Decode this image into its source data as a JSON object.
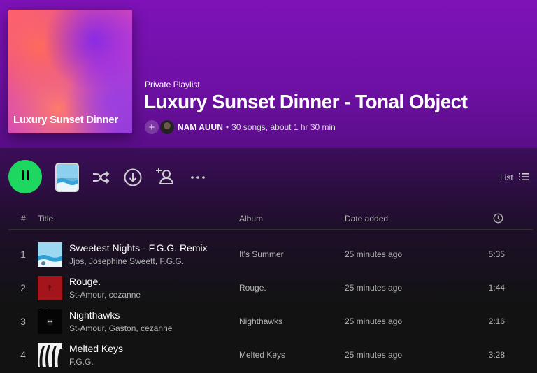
{
  "playlist": {
    "type_label": "Private Playlist",
    "title": "Luxury Sunset Dinner - Tonal Object",
    "cover_text": "Luxury Sunset Dinner",
    "owner": "NAM AUUN",
    "stats": "30 songs, about 1 hr 30 min",
    "separator": "•"
  },
  "controls": {
    "view_label": "List",
    "accent_color": "#1ed760",
    "icons": [
      "pause-icon",
      "playlist-cover-thumbnail",
      "shuffle-icon",
      "download-icon",
      "add-user-icon",
      "more-options-icon",
      "list-view-icon"
    ]
  },
  "table": {
    "headers": {
      "number": "#",
      "title": "Title",
      "album": "Album",
      "date_added": "Date added",
      "duration_icon": "clock-icon"
    },
    "tracks": [
      {
        "num": "1",
        "title": "Sweetest Nights - F.G.G. Remix",
        "artists": "Jjos, Josephine Sweett, F.G.G.",
        "album": "It's Summer",
        "date_added": "25 minutes ago",
        "duration": "5:35"
      },
      {
        "num": "2",
        "title": "Rouge.",
        "artists": "St-Amour, cezanne",
        "album": "Rouge.",
        "date_added": "25 minutes ago",
        "duration": "1:44"
      },
      {
        "num": "3",
        "title": "Nighthawks",
        "artists": "St-Amour, Gaston, cezanne",
        "album": "Nighthawks",
        "date_added": "25 minutes ago",
        "duration": "2:16"
      },
      {
        "num": "4",
        "title": "Melted Keys",
        "artists": "F.G.G.",
        "album": "Melted Keys",
        "date_added": "25 minutes ago",
        "duration": "3:28"
      }
    ]
  }
}
